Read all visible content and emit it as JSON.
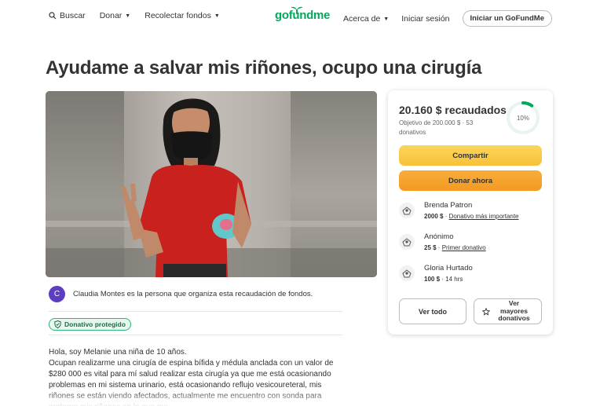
{
  "nav": {
    "search_label": "Buscar",
    "donate_label": "Donar",
    "fundraise_label": "Recolectar fondos",
    "logo_text": "gofundme",
    "about_label": "Acerca de",
    "login_label": "Iniciar sesión",
    "start_label": "Iniciar un GoFundMe"
  },
  "campaign": {
    "title": "Ayudame a salvar mis riñones, ocupo una cirugía",
    "organizer_initial": "C",
    "organizer_text": "Claudia Montes es la persona que organiza esta recaudación de fondos.",
    "protected_badge": "Donativo protegido",
    "story_line1": "Hola, soy Melanie una niña de 10 años.",
    "story_line2": "Ocupan realizarme una cirugía de espina bífida y médula anclada con un valor de $280 000 es vital para mí salud realizar esta cirugía ya que me está ocasionando problemas en mi sistema urinario, está ocasionando reflujo vesicoureteral, mis riñones se están viendo afectados, actualmente me encuentro con sonda para proteger mis riñones en lo que me"
  },
  "sidebar": {
    "raised": "20.160 $ recaudados",
    "goal": "Objetivo de 200.000 $",
    "separator": "·",
    "donations_count": "53 donativos",
    "progress_label": "10%",
    "progress_fraction": 0.1,
    "share_label": "Compartir",
    "donate_label": "Donar ahora",
    "donations": [
      {
        "name": "Brenda Patron",
        "amount": "2000 $",
        "note": "Donativo más importante"
      },
      {
        "name": "Anónimo",
        "amount": "25 $",
        "note": "Primer donativo"
      },
      {
        "name": "Gloria Hurtado",
        "amount": "100 $",
        "note": "14 hrs"
      }
    ],
    "see_all_label": "Ver todo",
    "see_top_label": "Ver mayores donativos"
  },
  "colors": {
    "brand_green": "#02a95c",
    "share_yellow": "#f8c13a",
    "donate_orange": "#f39a22",
    "avatar_purple": "#5b3fc0"
  }
}
